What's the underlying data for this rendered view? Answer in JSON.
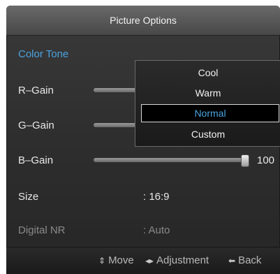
{
  "window": {
    "title": "Picture Options"
  },
  "menu": {
    "rows": [
      {
        "label": "Color Tone"
      },
      {
        "label": "R–Gain"
      },
      {
        "label": "G–Gain"
      },
      {
        "label": "B–Gain",
        "value": "100",
        "level": 1.0
      },
      {
        "label": "Size",
        "value": ": 16:9"
      },
      {
        "label": "Digital NR",
        "value": ": Auto"
      }
    ]
  },
  "dropdown": {
    "options": [
      "Cool",
      "Warm",
      "Normal",
      "Custom"
    ],
    "selected": "Normal"
  },
  "footer": {
    "move": "Move",
    "adjust": "Adjustment",
    "back": "Back",
    "move_icon": "updown-arrow-icon",
    "adjust_icon": "leftright-arrow-icon",
    "back_icon": "back-arrow-icon"
  },
  "colors": {
    "accent": "#4aa3e0",
    "disabled": "#8a8a8a"
  }
}
